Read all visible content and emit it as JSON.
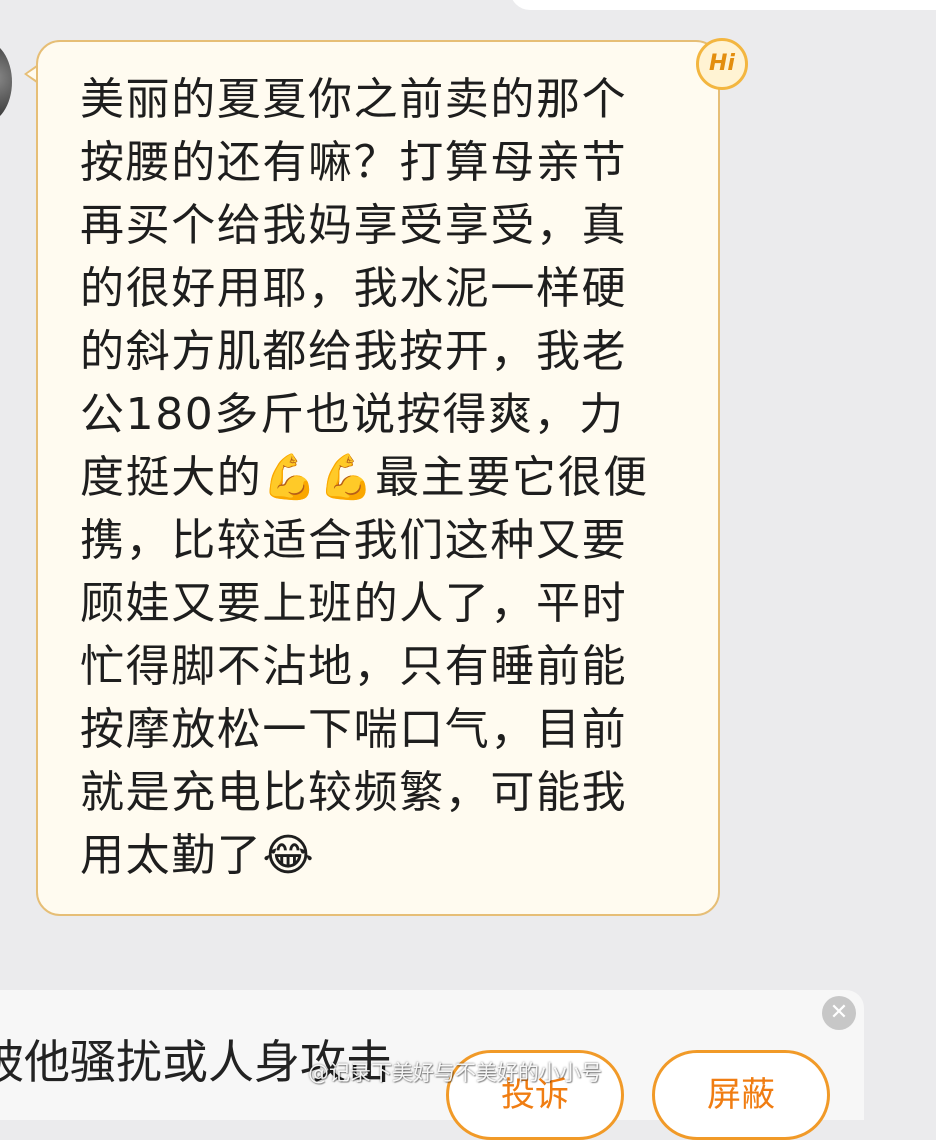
{
  "chat": {
    "message_text": "美丽的夏夏你之前卖的那个\n按腰的还有嘛？打算母亲节\n再买个给我妈享受享受，真\n的很好用耶，我水泥一样硬\n的斜方肌都给我按开，我老\n公180多斤也说按得爽，力\n度挺大的💪💪最主要它很便\n携，比较适合我们这种又要\n顾娃又要上班的人了，平时\n忙得脚不沾地，只有睡前能\n按摩放松一下喘口气，目前\n就是充电比较频繁，可能我\n用太勤了😂",
    "badge_text": "Hi"
  },
  "panel": {
    "text": "被他骚扰或人身攻击",
    "report_label": "投诉",
    "block_label": "屏蔽",
    "close_glyph": "✕"
  },
  "watermark": {
    "text": "@记录下美好与不美好的小小号"
  },
  "colors": {
    "bubble_bg": "#fffbf0",
    "bubble_border": "#e6be76",
    "accent_orange": "#f07d12",
    "page_bg": "#ebebed"
  },
  "icons": {
    "avatar": "avatar",
    "badge": "hi-badge-icon",
    "close": "close-icon"
  }
}
